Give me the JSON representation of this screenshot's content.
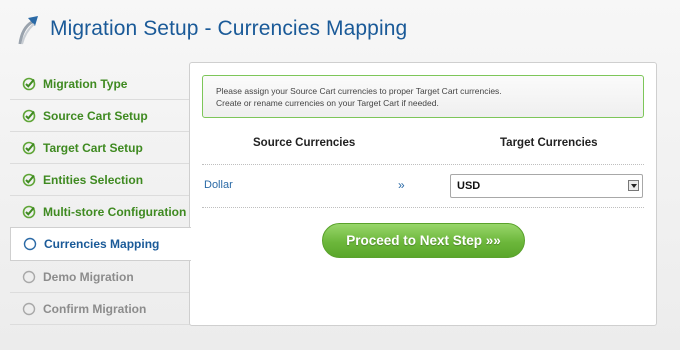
{
  "header": {
    "title": "Migration Setup - Currencies Mapping",
    "logo_icon": "migration-arrow-logo"
  },
  "sidebar": {
    "steps": [
      {
        "label": "Migration Type",
        "state": "done"
      },
      {
        "label": "Source Cart Setup",
        "state": "done"
      },
      {
        "label": "Target Cart Setup",
        "state": "done"
      },
      {
        "label": "Entities Selection",
        "state": "done"
      },
      {
        "label": "Multi-store Configuration",
        "state": "done"
      },
      {
        "label": "Currencies Mapping",
        "state": "active"
      },
      {
        "label": "Demo Migration",
        "state": "pending"
      },
      {
        "label": "Confirm Migration",
        "state": "pending"
      }
    ]
  },
  "notice": {
    "line1": "Please assign your Source Cart currencies to proper Target Cart currencies.",
    "line2": "Create or rename currencies on your Target Cart if needed."
  },
  "mapping": {
    "source_header": "Source Currencies",
    "target_header": "Target Currencies",
    "rows": [
      {
        "source": "Dollar",
        "arrow": "»",
        "target": "USD"
      }
    ]
  },
  "actions": {
    "proceed_label": "Proceed to Next Step »»"
  },
  "colors": {
    "title": "#1a5a98",
    "done": "#3f8a21",
    "pending": "#8c8c8c",
    "button": "#6cb73b"
  }
}
